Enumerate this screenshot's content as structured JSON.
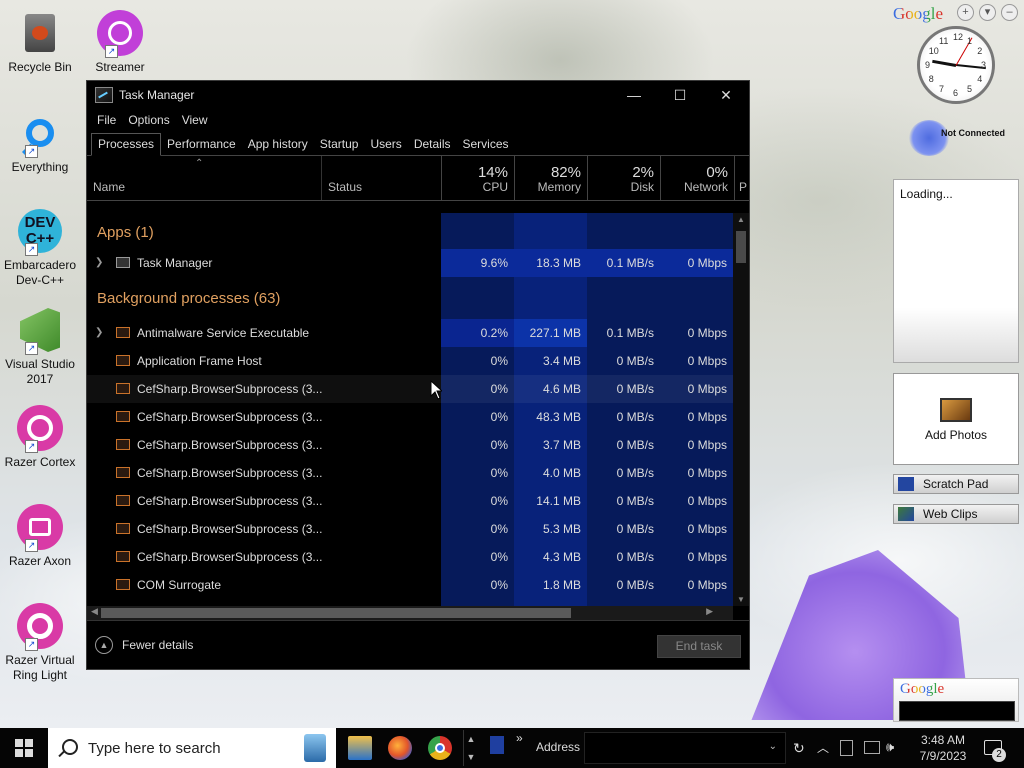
{
  "desktop": {
    "icons": [
      {
        "label": "Recycle Bin"
      },
      {
        "label": "Streamer"
      },
      {
        "label": "Everything"
      },
      {
        "label": "Embarcadero Dev-C++"
      },
      {
        "label": "Visual Studio 2017"
      },
      {
        "label": "Razer Cortex"
      },
      {
        "label": "Razer Axon"
      },
      {
        "label": "Razer Virtual Ring Light"
      }
    ],
    "devcpp_logo": "DEV C++"
  },
  "taskmanager": {
    "title": "Task Manager",
    "controls": {
      "minimize": "—",
      "maximize": "☐",
      "close": "✕"
    },
    "menu": [
      "File",
      "Options",
      "View"
    ],
    "tabs": [
      "Processes",
      "Performance",
      "App history",
      "Startup",
      "Users",
      "Details",
      "Services"
    ],
    "columns": {
      "name": "Name",
      "status": "Status",
      "cpu": {
        "pct": "14%",
        "label": "CPU"
      },
      "memory": {
        "pct": "82%",
        "label": "Memory"
      },
      "disk": {
        "pct": "2%",
        "label": "Disk"
      },
      "network": {
        "pct": "0%",
        "label": "Network"
      },
      "power": "P"
    },
    "groups": {
      "apps": "Apps (1)",
      "background": "Background processes (63)"
    },
    "app_rows": [
      {
        "name": "Task Manager",
        "cpu": "9.6%",
        "memory": "18.3 MB",
        "disk": "0.1 MB/s",
        "network": "0 Mbps"
      }
    ],
    "bg_rows": [
      {
        "name": "Antimalware Service Executable",
        "cpu": "0.2%",
        "memory": "227.1 MB",
        "disk": "0.1 MB/s",
        "network": "0 Mbps"
      },
      {
        "name": "Application Frame Host",
        "cpu": "0%",
        "memory": "3.4 MB",
        "disk": "0 MB/s",
        "network": "0 Mbps"
      },
      {
        "name": "CefSharp.BrowserSubprocess (3...",
        "cpu": "0%",
        "memory": "4.6 MB",
        "disk": "0 MB/s",
        "network": "0 Mbps"
      },
      {
        "name": "CefSharp.BrowserSubprocess (3...",
        "cpu": "0%",
        "memory": "48.3 MB",
        "disk": "0 MB/s",
        "network": "0 Mbps"
      },
      {
        "name": "CefSharp.BrowserSubprocess (3...",
        "cpu": "0%",
        "memory": "3.7 MB",
        "disk": "0 MB/s",
        "network": "0 Mbps"
      },
      {
        "name": "CefSharp.BrowserSubprocess (3...",
        "cpu": "0%",
        "memory": "4.0 MB",
        "disk": "0 MB/s",
        "network": "0 Mbps"
      },
      {
        "name": "CefSharp.BrowserSubprocess (3...",
        "cpu": "0%",
        "memory": "14.1 MB",
        "disk": "0 MB/s",
        "network": "0 Mbps"
      },
      {
        "name": "CefSharp.BrowserSubprocess (3...",
        "cpu": "0%",
        "memory": "5.3 MB",
        "disk": "0 MB/s",
        "network": "0 Mbps"
      },
      {
        "name": "CefSharp.BrowserSubprocess (3...",
        "cpu": "0%",
        "memory": "4.3 MB",
        "disk": "0 MB/s",
        "network": "0 Mbps"
      },
      {
        "name": "COM Surrogate",
        "cpu": "0%",
        "memory": "1.8 MB",
        "disk": "0 MB/s",
        "network": "0 Mbps"
      }
    ],
    "footer": {
      "fewer": "Fewer details",
      "end_task": "End task"
    },
    "colors": {
      "cpu_heat": "#0b2a8a",
      "memory_heat": "#0c33a8",
      "group_text": "#e0a060"
    }
  },
  "gadgets": {
    "google_logo": "Google",
    "clock_time": "3:48",
    "network_status": "Not Connected",
    "loading": "Loading...",
    "add_photos": "Add Photos",
    "scratch_pad": "Scratch Pad",
    "web_clips": "Web Clips",
    "search_logo": "Google",
    "clock_numbers": [
      "12",
      "1",
      "2",
      "3",
      "4",
      "5",
      "6",
      "7",
      "8",
      "9",
      "10",
      "11"
    ]
  },
  "taskbar": {
    "search_placeholder": "Type here to search",
    "address_label": "Address",
    "chevron": "»",
    "time": "3:48 AM",
    "date": "7/9/2023",
    "notification_count": "2"
  }
}
